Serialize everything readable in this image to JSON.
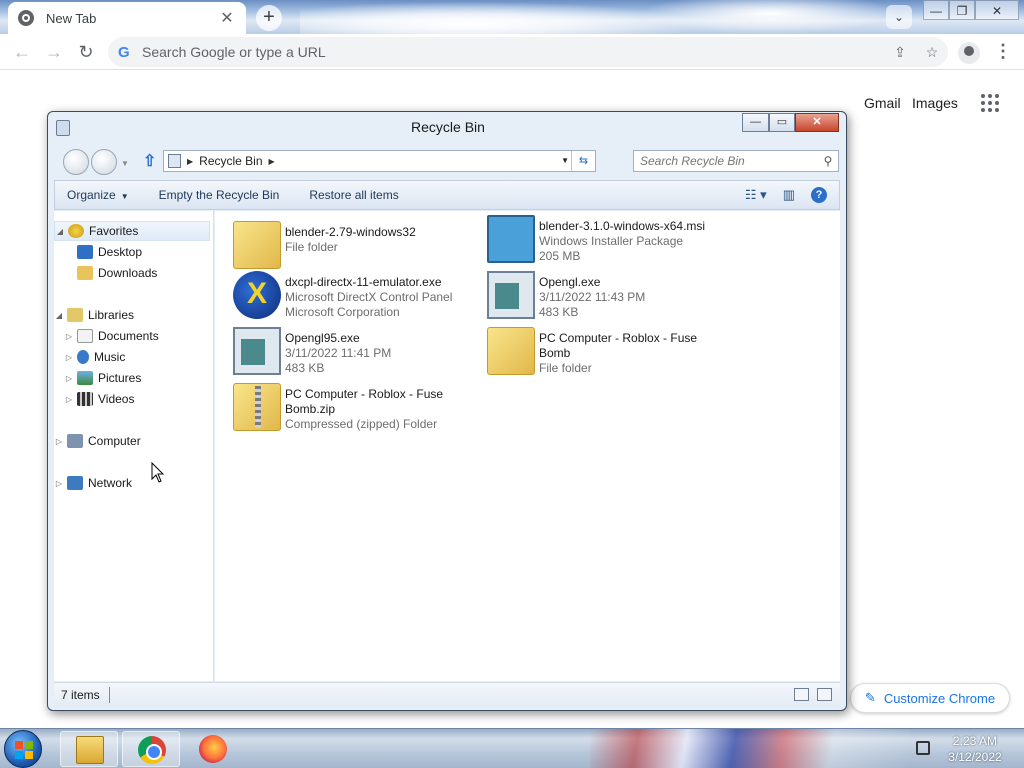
{
  "browser": {
    "tab_title": "New Tab",
    "tab_close": "✕",
    "new_tab": "+",
    "tab_search": "⌄",
    "window_controls": {
      "minimize": "—",
      "restore": "❐",
      "close": "✕"
    },
    "back": "←",
    "forward": "→",
    "reload": "↻",
    "omnibox_g": "G",
    "omnibox_placeholder": "Search Google or type a URL",
    "share_icon": "⇪",
    "bookmark_icon": "☆",
    "menu": "⋮"
  },
  "ntp": {
    "gmail": "Gmail",
    "images": "Images",
    "customize_icon": "✎",
    "customize": "Customize Chrome"
  },
  "explorer": {
    "title": "Recycle Bin",
    "controls": {
      "minimize": "—",
      "maximize": "▭",
      "close": "✕"
    },
    "up_arrow": "⇧",
    "address": {
      "sep": "▶",
      "crumb": "Recycle Bin",
      "dropdown": "▼",
      "refresh": "⇆"
    },
    "search_placeholder": "Search Recycle Bin",
    "search_icon": "⚲",
    "commands": {
      "organize": "Organize",
      "organize_caret": "▼",
      "empty": "Empty the Recycle Bin",
      "restore": "Restore all items"
    },
    "view_icons": {
      "change_view": "☷ ▾",
      "preview_pane": "▥",
      "help": "?"
    },
    "nav": {
      "favorites": "Favorites",
      "desktop": "Desktop",
      "downloads": "Downloads",
      "libraries": "Libraries",
      "documents": "Documents",
      "music": "Music",
      "pictures": "Pictures",
      "videos": "Videos",
      "computer": "Computer",
      "network": "Network",
      "expanded": "◢",
      "collapsed": "▷"
    },
    "files": [
      {
        "name": "blender-2.79-windows32",
        "meta1": "File folder",
        "meta2": ""
      },
      {
        "name": "blender-3.1.0-windows-x64.msi",
        "meta1": "Windows Installer Package",
        "meta2": "205 MB"
      },
      {
        "name": "dxcpl-directx-11-emulator.exe",
        "meta1": "Microsoft DirectX Control Panel",
        "meta2": "Microsoft Corporation"
      },
      {
        "name": "Opengl.exe",
        "meta1": "3/11/2022 11:43 PM",
        "meta2": "483 KB"
      },
      {
        "name": "Opengl95.exe",
        "meta1": "3/11/2022 11:41 PM",
        "meta2": "483 KB"
      },
      {
        "name": "PC Computer - Roblox - Fuse Bomb",
        "meta1": "File folder",
        "meta2": ""
      },
      {
        "name": "PC Computer - Roblox - Fuse Bomb.zip",
        "meta1": "Compressed (zipped) Folder",
        "meta2": ""
      }
    ],
    "status": "7 items"
  },
  "taskbar": {
    "time": "2:23 AM",
    "date": "3/12/2022"
  },
  "colors": {
    "accent": "#1a73e8",
    "explorer_frame": "#e6eef8",
    "command_text": "#1e395b"
  }
}
